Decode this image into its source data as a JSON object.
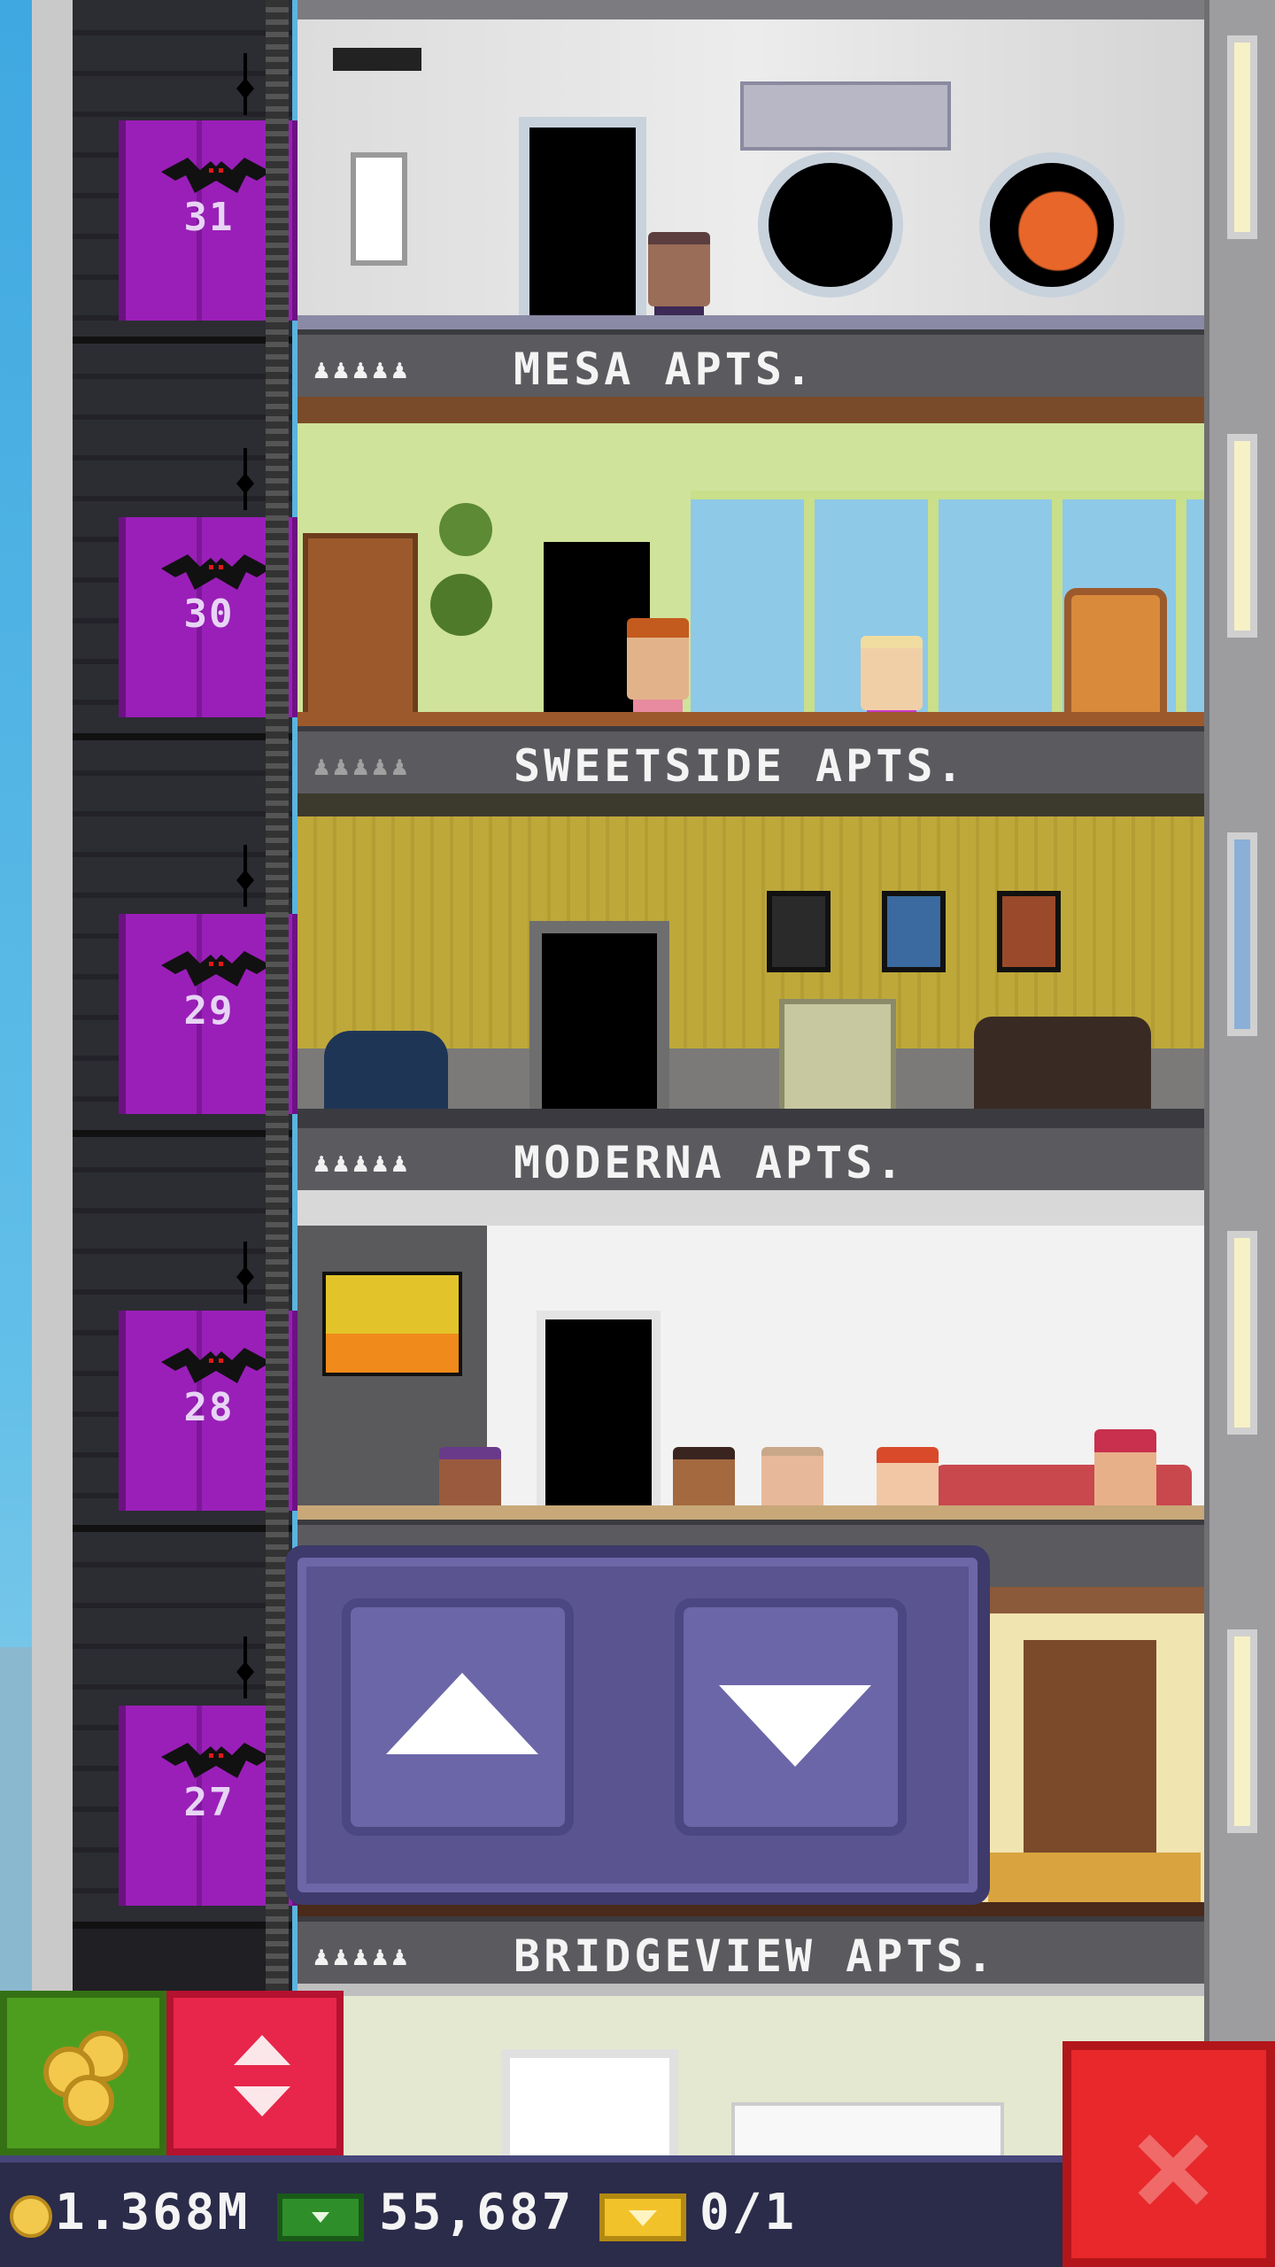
{
  "floors": [
    {
      "elevator_number": "31",
      "name": "MESA APTS.",
      "occupancy_icons": "♟♟♟♟♟",
      "occupancy_dim": false,
      "theme": "space"
    },
    {
      "elevator_number": "30",
      "name": "SWEETSIDE APTS.",
      "occupancy_icons": "♟♟♟♟♟",
      "occupancy_dim": true,
      "theme": "lime"
    },
    {
      "elevator_number": "29",
      "name": "MODERNA APTS.",
      "occupancy_icons": "♟♟♟♟♟",
      "occupancy_dim": false,
      "theme": "olive"
    },
    {
      "elevator_number": "28",
      "name": "",
      "occupancy_icons": "",
      "occupancy_dim": false,
      "theme": "white"
    },
    {
      "elevator_number": "27",
      "name": "BRIDGEVIEW APTS.",
      "occupancy_icons": "♟♟♟♟♟",
      "occupancy_dim": false,
      "theme": "cream"
    }
  ],
  "controls": {
    "up_icon": "up-arrow-icon",
    "down_icon": "down-arrow-icon",
    "coins_icon": "coins-icon",
    "elevator_icon": "elevator-updown-icon",
    "close_icon": "close-icon"
  },
  "status": {
    "coins": "1.368M",
    "bux": "55,687",
    "tickets": "0/1"
  },
  "colors": {
    "elevator": "#9a1fb8",
    "panel": "#5a5491",
    "coins_button": "#4d9e1f",
    "elevator_button": "#e8254a",
    "close_button": "#e8282a",
    "statusbar": "#2b2b4a"
  }
}
